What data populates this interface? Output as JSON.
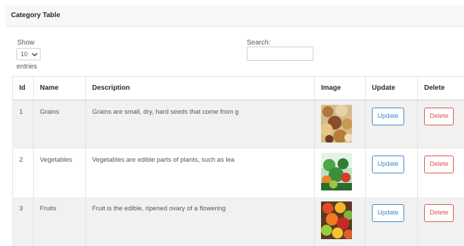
{
  "card": {
    "title": "Category Table"
  },
  "length_control": {
    "show_label": "Show",
    "selected": "10",
    "suffix": "entries"
  },
  "search": {
    "label": "Search:",
    "value": "",
    "placeholder": ""
  },
  "table": {
    "headers": [
      "Id",
      "Name",
      "Description",
      "Image",
      "Update",
      "Delete"
    ],
    "rows": [
      {
        "id": "1",
        "name": "Grains",
        "description": "Grains are small, dry, hard seeds that come from g",
        "image": "grains-thumbnail",
        "update_label": "Update",
        "delete_label": "Delete"
      },
      {
        "id": "2",
        "name": "Vegetables",
        "description": "Vegetables are edible parts of plants, such as lea",
        "image": "vegetables-thumbnail",
        "update_label": "Update",
        "delete_label": "Delete"
      },
      {
        "id": "3",
        "name": "Fruits",
        "description": "Fruit is the edible, ripened ovary of a flowering",
        "image": "fruits-thumbnail",
        "update_label": "Update",
        "delete_label": "Delete"
      }
    ]
  },
  "colors": {
    "update_accent": "#3b86cc",
    "delete_accent": "#d9534f",
    "stripe": "#f1f1f1",
    "header_bg": "#f7f7f7"
  }
}
